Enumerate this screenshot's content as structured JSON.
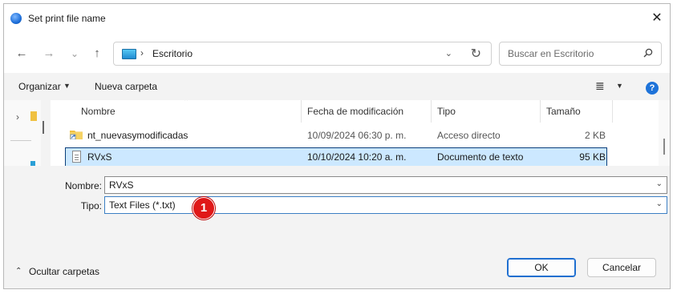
{
  "window": {
    "title": "Set print file name",
    "close_glyph": "✕"
  },
  "nav": {
    "back_glyph": "←",
    "forward_glyph": "→",
    "recent_glyph": "⌄",
    "up_glyph": "↑",
    "address": {
      "separator": "›",
      "location": "Escritorio",
      "dropdown_glyph": "⌄",
      "refresh_glyph": "↻"
    },
    "search": {
      "placeholder": "Buscar en Escritorio"
    }
  },
  "toolbar": {
    "organize_label": "Organizar",
    "organize_caret": "▼",
    "new_folder_label": "Nueva carpeta",
    "view_glyph": "≣",
    "view_caret": "▼",
    "help_glyph": "?"
  },
  "file_list": {
    "sort_glyph": "⌃",
    "columns": [
      "Nombre",
      "Fecha de modificación",
      "Tipo",
      "Tamaño"
    ],
    "rows": [
      {
        "name": "nt_nuevasymodificadas",
        "modified": "10/09/2024 06:30 p. m.",
        "type": "Acceso directo",
        "size": "2 KB",
        "icon": "folder-shortcut-icon",
        "selected": false
      },
      {
        "name": "RVxS",
        "modified": "10/10/2024 10:20 a. m.",
        "type": "Documento de texto",
        "size": "95 KB",
        "icon": "text-file-icon",
        "selected": true
      }
    ]
  },
  "form": {
    "name_label": "Nombre:",
    "name_value": "RVxS",
    "type_label": "Tipo:",
    "type_value": "Text Files (*.txt)",
    "dropdown_glyph": "⌄"
  },
  "annotation": {
    "badge_number": "1",
    "color": "#e01818"
  },
  "footer": {
    "hide_folders_caret": "⌃",
    "hide_folders_label": "Ocultar carpetas",
    "ok_label": "OK",
    "cancel_label": "Cancelar"
  },
  "left_pane": {
    "expand_glyph": "›"
  },
  "colors": {
    "accent": "#1f6fd0",
    "selection": "#cce8ff",
    "background": "#f3f3f3"
  }
}
